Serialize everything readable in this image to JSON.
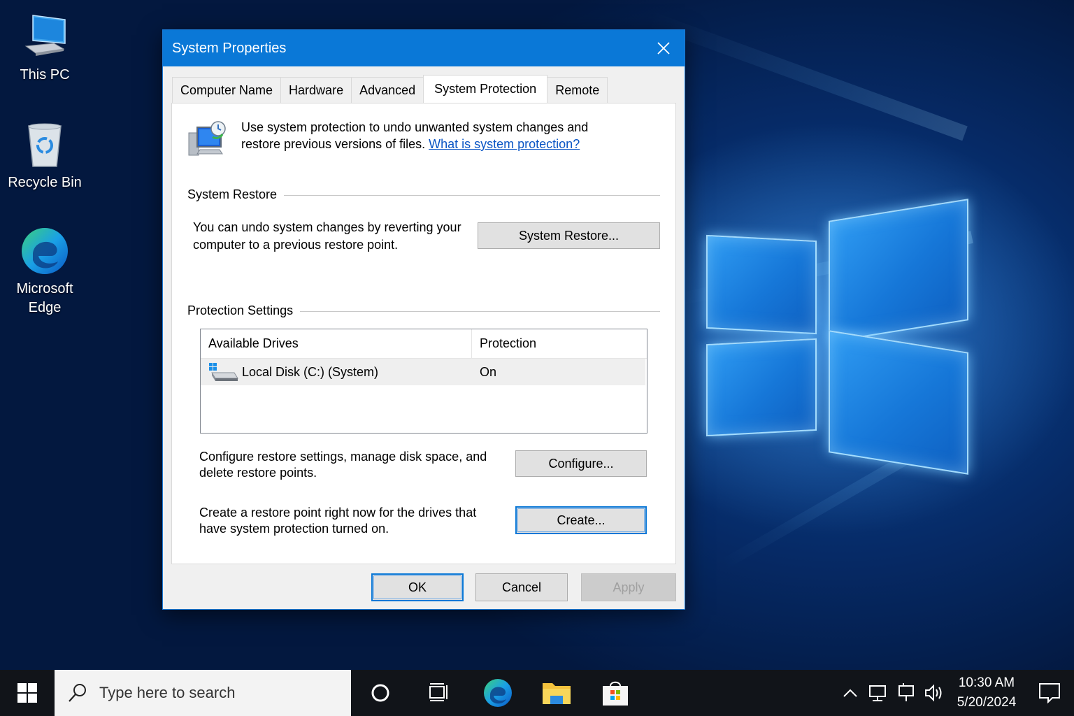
{
  "desktop": {
    "icons": [
      {
        "label": "This PC",
        "icon": "this-pc-icon"
      },
      {
        "label": "Recycle Bin",
        "icon": "recycle-bin-icon"
      },
      {
        "label": "Microsoft Edge",
        "icon": "edge-icon"
      }
    ]
  },
  "dialog": {
    "title": "System Properties",
    "tabs": [
      "Computer Name",
      "Hardware",
      "Advanced",
      "System Protection",
      "Remote"
    ],
    "active_tab": "System Protection",
    "intro": {
      "text": "Use system protection to undo unwanted system changes and restore previous versions of files.",
      "link": "What is system protection?"
    },
    "system_restore": {
      "heading": "System Restore",
      "description": "You can undo system changes by reverting your computer to a previous restore point.",
      "button": "System Restore..."
    },
    "protection_settings": {
      "heading": "Protection Settings",
      "columns": [
        "Available Drives",
        "Protection"
      ],
      "rows": [
        {
          "drive": "Local Disk (C:) (System)",
          "protection": "On"
        }
      ],
      "configure_text": "Configure restore settings, manage disk space, and delete restore points.",
      "configure_button": "Configure...",
      "create_text": "Create a restore point right now for the drives that have system protection turned on.",
      "create_button": "Create..."
    },
    "buttons": {
      "ok": "OK",
      "cancel": "Cancel",
      "apply": "Apply"
    }
  },
  "taskbar": {
    "search_placeholder": "Type here to search",
    "time": "10:30 AM",
    "date": "5/20/2024"
  },
  "colors": {
    "titlebar": "#0a78d7",
    "accent": "#0a78d7",
    "taskbar": "#111419"
  }
}
